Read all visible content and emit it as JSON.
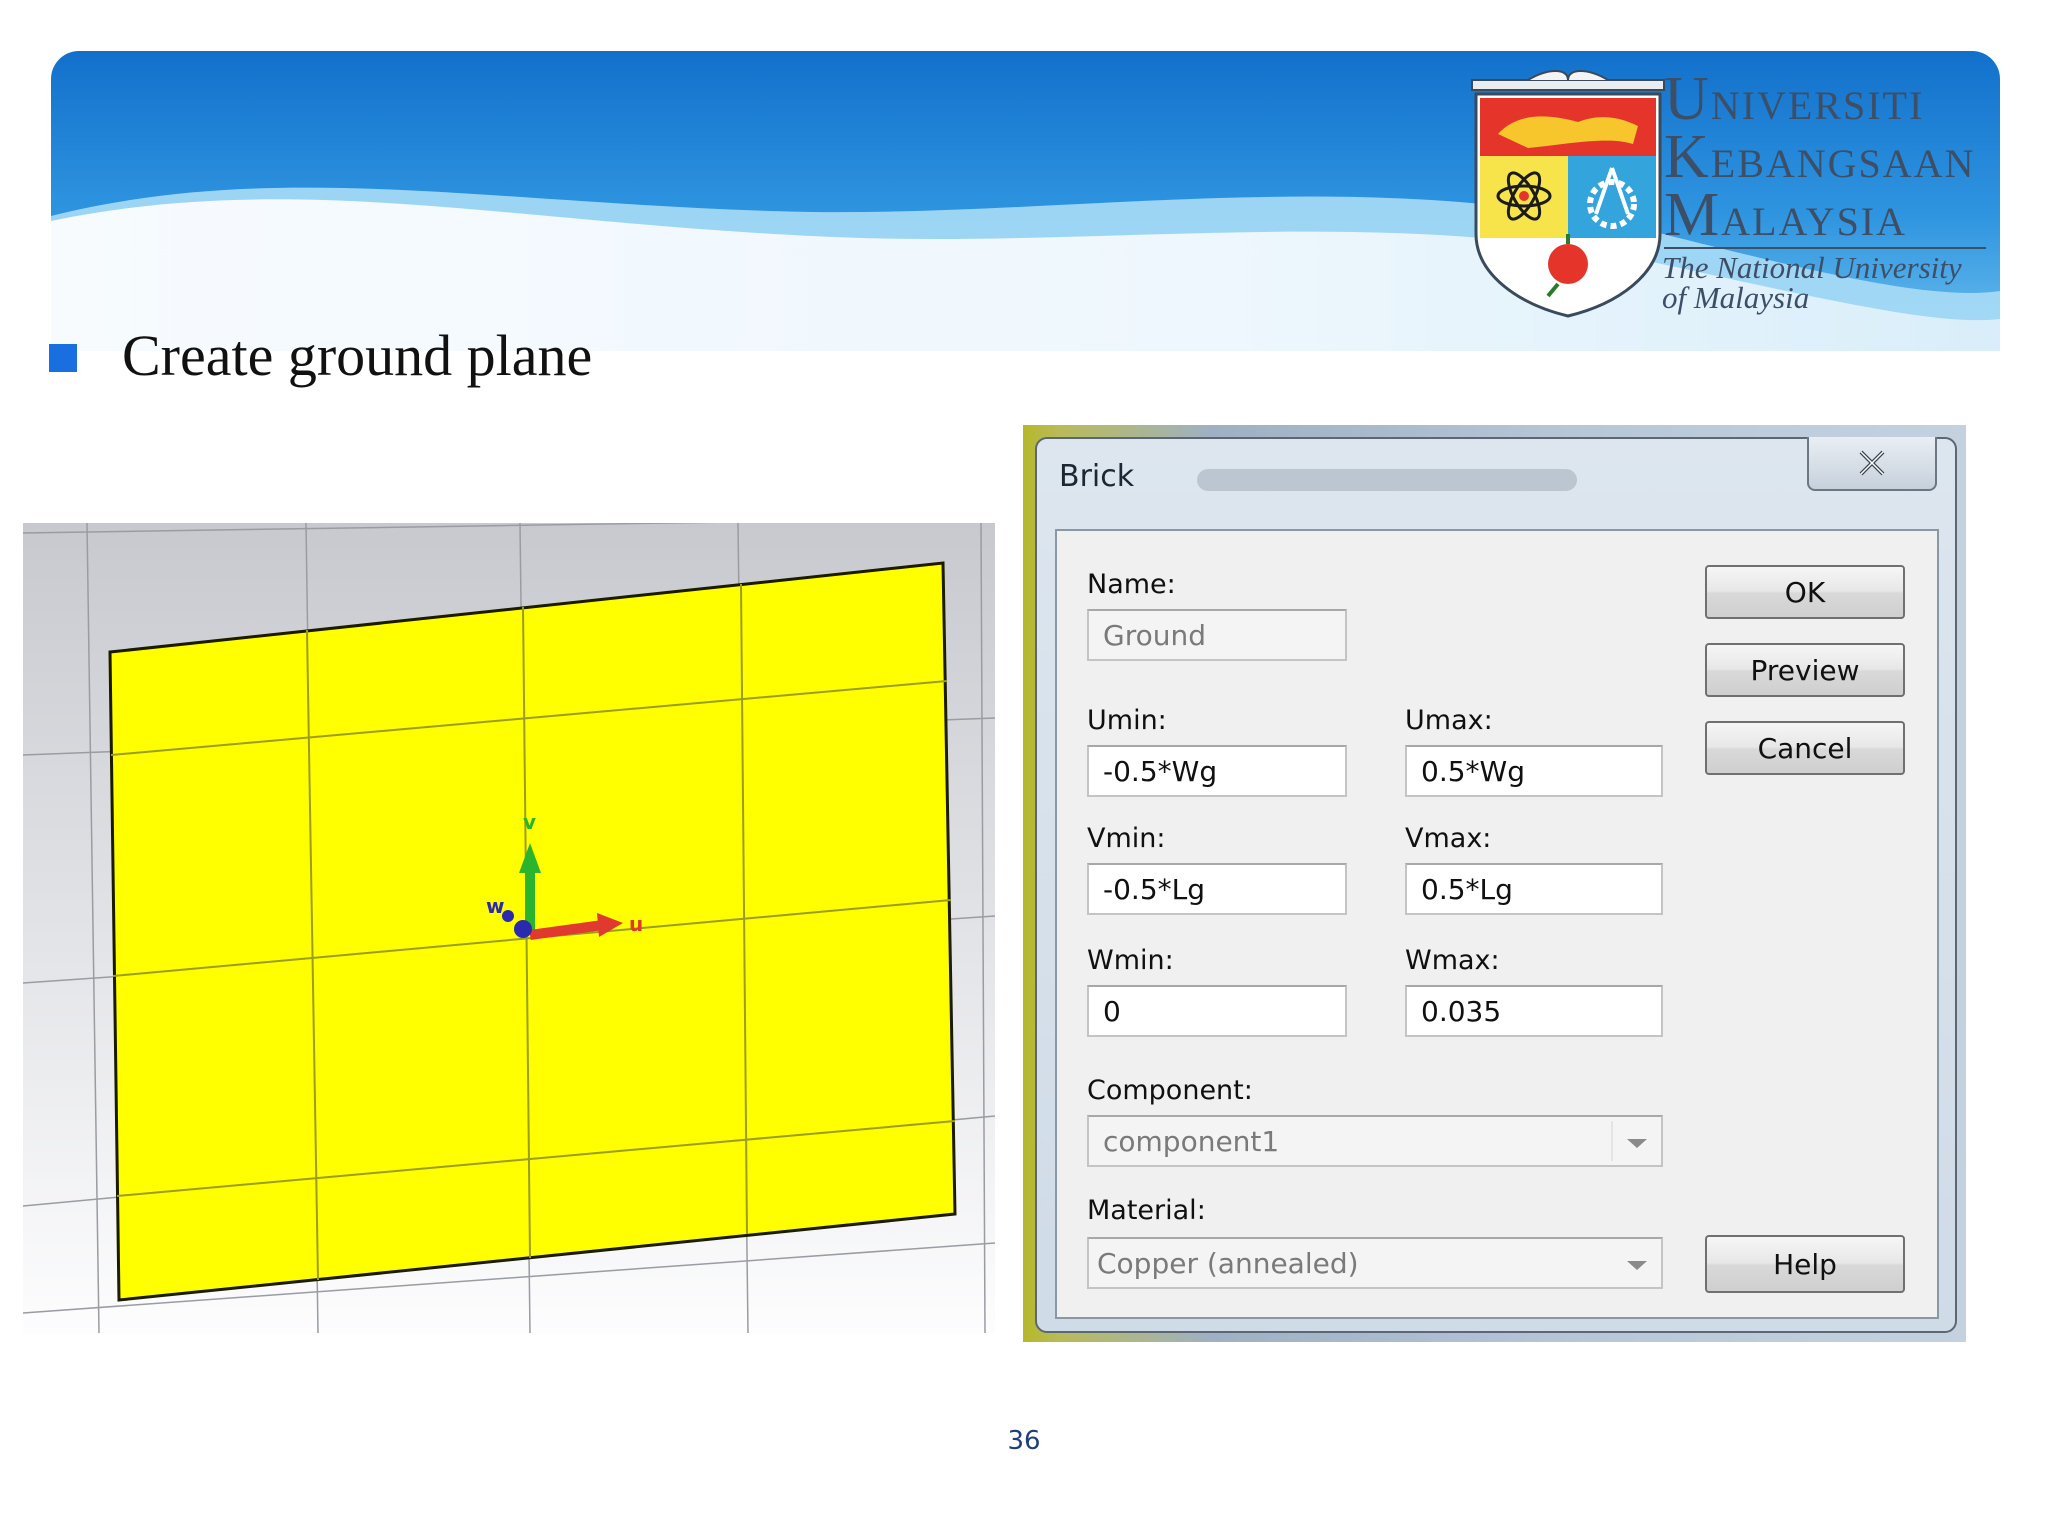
{
  "header": {
    "university_lines": [
      {
        "cap": "U",
        "rest": "NIVERSITI"
      },
      {
        "cap": "K",
        "rest": "EBANGSAAN"
      },
      {
        "cap": "M",
        "rest": "ALAYSIA"
      }
    ],
    "tagline_line1": "The National University",
    "tagline_line2": "of Malaysia",
    "colors": {
      "banner_dark": "#1279cf",
      "banner_light": "#8fd0f2",
      "text": "#3c4f66"
    }
  },
  "slide": {
    "bullet_text": "Create ground plane",
    "bullet_color": "#1a6fe0",
    "page_number": "36"
  },
  "viewport": {
    "plane_color": "#ffff00",
    "axis_labels": {
      "u": "u",
      "v": "v",
      "w": "w"
    }
  },
  "dialog": {
    "title": "Brick",
    "close_icon": "close-icon",
    "fields": {
      "name": {
        "label": "Name:",
        "value": "Ground"
      },
      "umin": {
        "label": "Umin:",
        "value": "-0.5*Wg"
      },
      "umax": {
        "label": "Umax:",
        "value": "0.5*Wg"
      },
      "vmin": {
        "label": "Vmin:",
        "value": "-0.5*Lg"
      },
      "vmax": {
        "label": "Vmax:",
        "value": "0.5*Lg"
      },
      "wmin": {
        "label": "Wmin:",
        "value": "0"
      },
      "wmax": {
        "label": "Wmax:",
        "value": "0.035"
      },
      "component": {
        "label": "Component:",
        "value": "component1"
      },
      "material": {
        "label": "Material:",
        "value": "Copper (annealed)"
      }
    },
    "buttons": {
      "ok": "OK",
      "preview": "Preview",
      "cancel": "Cancel",
      "help": "Help"
    }
  }
}
